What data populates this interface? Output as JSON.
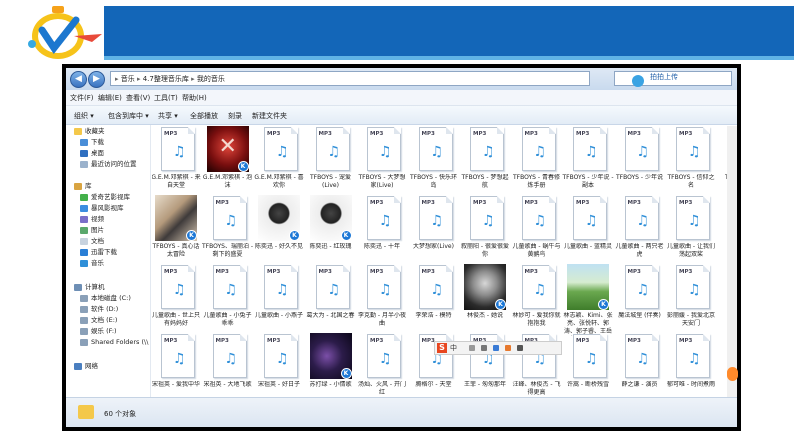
{
  "address": {
    "crumbs": [
      "音乐",
      "4.7整理音乐库",
      "我的音乐"
    ],
    "upload_label": "拍拍上传"
  },
  "menu": [
    "文件(F)",
    "编辑(E)",
    "查看(V)",
    "工具(T)",
    "帮助(H)"
  ],
  "toolbar": [
    "组织 ▾",
    "包含到库中 ▾",
    "共享 ▾",
    "全部播放",
    "刻录",
    "新建文件夹"
  ],
  "sidebar": {
    "favorites_header": "收藏夹",
    "favorites": [
      "下载",
      "桌面",
      "最近访问的位置"
    ],
    "libraries_header": "库",
    "libraries": [
      "爱奇艺影视库",
      "暴风影视库",
      "视频",
      "图片",
      "文档",
      "迅雷下载",
      "音乐"
    ],
    "computer_header": "计算机",
    "drives": [
      "本地磁盘 (C:)",
      "软件 (D:)",
      "文档 (E:)",
      "娱乐 (F:)",
      "Shared Folders (\\\\"
    ],
    "network_header": "网络"
  },
  "files": [
    {
      "label": "G.E.M.邓紫棋 - 来自天堂",
      "art": "mp3"
    },
    {
      "label": "G.E.M.邓紫棋 - 泡沫",
      "art": "red-x"
    },
    {
      "label": "G.E.M.邓紫棋 - 喜欢你",
      "art": "mp3"
    },
    {
      "label": "TFBOYS - 宠爱 (Live)",
      "art": "mp3"
    },
    {
      "label": "TFBOYS - 大梦想家(Live)",
      "art": "mp3"
    },
    {
      "label": "TFBOYS - 快乐环岛",
      "art": "mp3"
    },
    {
      "label": "TFBOYS - 梦想起航",
      "art": "mp3"
    },
    {
      "label": "TFBOYS - 青春修炼手册",
      "art": "mp3"
    },
    {
      "label": "TFBOYS - 少年说 - 副本",
      "art": "mp3"
    },
    {
      "label": "TFBOYS - 少年说",
      "art": "mp3"
    },
    {
      "label": "TFBOYS - 信仰之名",
      "art": "mp3"
    },
    {
      "label": "TFBOYS - 样 (YOUNG)",
      "art": "mp3"
    },
    {
      "label": "TFBOYS - 真心话太冒险",
      "art": "group-photo"
    },
    {
      "label": "TFBOYS、瑞丽泊 - 剩下的盛夏",
      "art": "mp3"
    },
    {
      "label": "陈奕迅 - 好久不见",
      "art": "sketch-portrait"
    },
    {
      "label": "陈奕迅 - 红玫瑰",
      "art": "sketch-portrait"
    },
    {
      "label": "陈奕迅 - 十年",
      "art": "mp3"
    },
    {
      "label": "大梦想家(Live)",
      "art": "mp3"
    },
    {
      "label": "叙丽阳 - 很爱很爱你",
      "art": "mp3"
    },
    {
      "label": "儿童歌曲 - 蜗牛与黄鹂鸟",
      "art": "mp3"
    },
    {
      "label": "儿童歌曲 - 蓝精灵",
      "art": "mp3"
    },
    {
      "label": "儿童歌曲 - 两只老虎",
      "art": "mp3"
    },
    {
      "label": "儿童歌曲 - 让我们荡起双桨",
      "art": "mp3"
    },
    {
      "label": "",
      "art": "mp3"
    },
    {
      "label": "儿童歌曲 - 世上只有妈妈好",
      "art": "mp3"
    },
    {
      "label": "儿童歌曲 - 小兔子乖乖",
      "art": "mp3"
    },
    {
      "label": "儿童歌曲 - 小燕子",
      "art": "mp3"
    },
    {
      "label": "葛大为 - 北国之春",
      "art": "mp3"
    },
    {
      "label": "李克勤 - 月半小夜曲",
      "art": "mp3"
    },
    {
      "label": "李荣浩 - 模特",
      "art": "mp3"
    },
    {
      "label": "林俊杰 - 她说",
      "art": "bw-portrait"
    },
    {
      "label": "林妙可 - 爱我你就抱抱我",
      "art": "mp3"
    },
    {
      "label": "林志颖、Kimi、张亮、张悦轩、郭涛、郭子睿、王岳伦、王诗龄...",
      "art": "grass-kids"
    },
    {
      "label": "魔法城堡 (伴奏)",
      "art": "mp3"
    },
    {
      "label": "彭丽媛 - 我爱北京天安门",
      "art": "mp3"
    },
    {
      "label": "",
      "art": "mp3"
    },
    {
      "label": "宋祖英 - 爱我中华",
      "art": "mp3"
    },
    {
      "label": "宋祖英 - 大地飞歌",
      "art": "mp3"
    },
    {
      "label": "宋祖英 - 好日子",
      "art": "mp3"
    },
    {
      "label": "苏打绿 - 小情歌",
      "art": "dark-concert"
    },
    {
      "label": "汤灿、火风 - 开门红",
      "art": "mp3"
    },
    {
      "label": "腾格尔 - 天堂",
      "art": "mp3"
    },
    {
      "label": "王菲 - 匆匆那年",
      "art": "mp3"
    },
    {
      "label": "汪峰、林俊杰 - 飞得更高",
      "art": "mp3"
    },
    {
      "label": "许嵩 - 断桥残雪",
      "art": "mp3"
    },
    {
      "label": "薛之谦 - 演员",
      "art": "mp3"
    },
    {
      "label": "郁可唯 - 时间煮雨",
      "art": "mp3"
    },
    {
      "label": "",
      "art": "mp3"
    }
  ],
  "status": {
    "count": "60 个对象"
  },
  "ime": {
    "mode": "中"
  },
  "file_type_badge": "MP3",
  "artist_badge": "K",
  "colors": {
    "banner": "#1366b8",
    "accent": "#5fb3e6",
    "note": "#2f8fd8"
  }
}
